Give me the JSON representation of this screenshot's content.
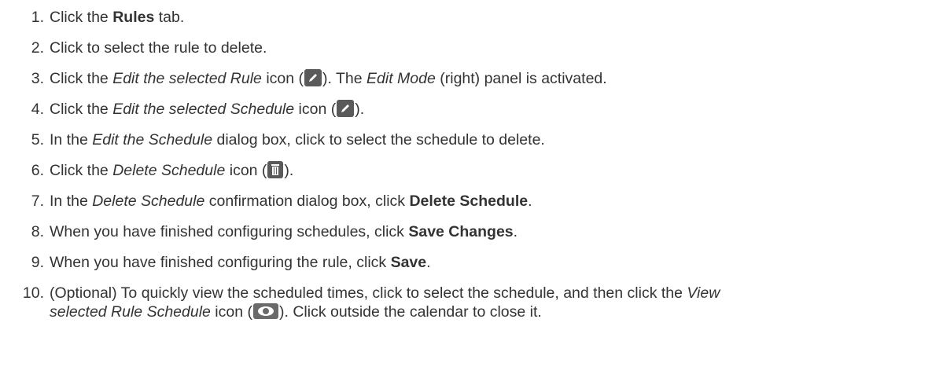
{
  "steps": [
    {
      "num": "1.",
      "a": "Click the ",
      "b": "Rules",
      "c": " tab."
    },
    {
      "num": "2.",
      "a": "Click to select the rule to delete."
    },
    {
      "num": "3.",
      "a": "Click the ",
      "i1": "Edit the selected Rule",
      "b2": " icon (",
      "c2": "). The ",
      "i2": "Edit Mode",
      "d": " (right) panel is activated."
    },
    {
      "num": "4.",
      "a": "Click the ",
      "i1": "Edit the selected Schedule",
      "b2": " icon (",
      "c2": ")."
    },
    {
      "num": "5.",
      "a": "In the ",
      "i1": "Edit the Schedule",
      "b2": " dialog box, click to select the schedule to delete."
    },
    {
      "num": "6.",
      "a": "Click the ",
      "i1": "Delete Schedule",
      "b2": " icon (",
      "c2": ")."
    },
    {
      "num": "7.",
      "a": "In the ",
      "i1": "Delete Schedule",
      "b2": " confirmation dialog box, click ",
      "bold": "Delete Schedule",
      "c2": "."
    },
    {
      "num": "8.",
      "a": "When you have finished configuring schedules, click ",
      "bold": "Save Changes",
      "c2": "."
    },
    {
      "num": "9.",
      "a": "When you have finished configuring the rule, click ",
      "bold": "Save",
      "c2": "."
    },
    {
      "num": "10.",
      "a": "(Optional) To quickly view the scheduled times, click to select the schedule, and then click the ",
      "i1": "View",
      "i2": "selected Rule Schedule",
      "b2": " icon (",
      "c2": "). Click outside the calendar to close it."
    }
  ],
  "icons": {
    "edit": "pencil-icon",
    "trash": "trash-icon",
    "eye": "eye-icon"
  },
  "colors": {
    "text": "#333333",
    "icon_bg": "#5a5a5a"
  }
}
